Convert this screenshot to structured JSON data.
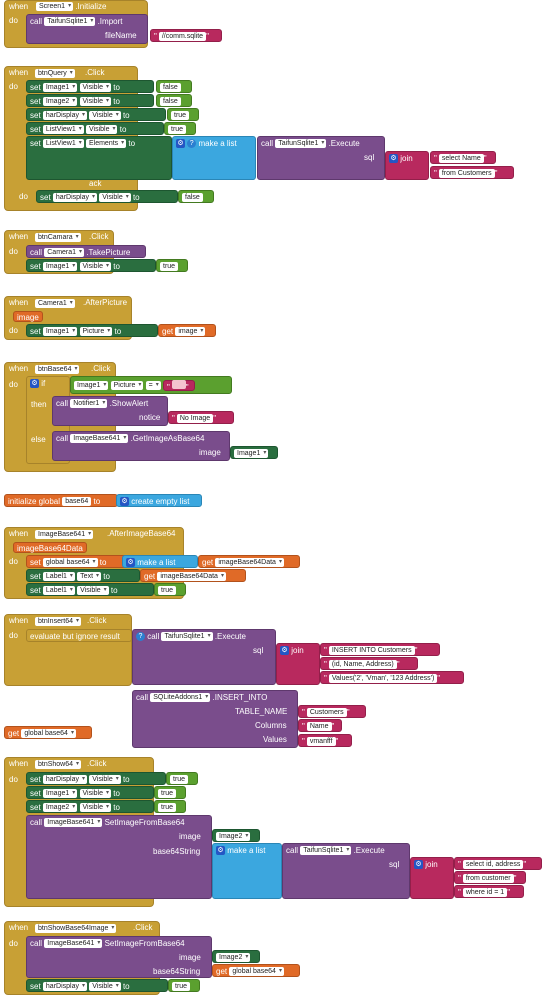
{
  "kw": {
    "when": "when",
    "do": "do",
    "set": "set",
    "to": "to",
    "call": "call",
    "if": "if",
    "then": "then",
    "else": "else",
    "get": "get",
    "make_a_list": "make a list",
    "join": "join",
    "create_empty_list": "create empty list",
    "evaluate_ignore": "evaluate but ignore result"
  },
  "props": {
    "visible": "Visible",
    "picture": "Picture",
    "elements": "Elements",
    "text": "Text",
    "image": "image",
    "filename": "fileName",
    "sql": "sql",
    "notice": "notice",
    "base64string": "base64String",
    "table_name": "TABLE_NAME",
    "columns": "Columns",
    "values": "Values"
  },
  "values": {
    "true": "true",
    "false": "false"
  },
  "block1": {
    "component": "Screen1",
    "event": ".Initialize",
    "call_component": "TaifunSqlite1",
    "method": ".Import",
    "file": "//comm.sqlite"
  },
  "block2": {
    "component": "btnQuery",
    "event": ".Click",
    "image1": "Image1",
    "image2": "Image2",
    "hardisplay": "harDisplay",
    "listview": "ListView1",
    "sqlite": "TaifunSqlite1",
    "method": ".Execute",
    "str1": "select Name",
    "str2": "from Customers",
    "ghost": "ack"
  },
  "block3": {
    "component": "btnCamara",
    "event": ".Click",
    "camera": "Camera1",
    "method": ".TakePicture",
    "image1": "Image1"
  },
  "block4": {
    "component": "Camera1",
    "event": ".AfterPicture",
    "param": "image",
    "image1": "Image1",
    "getvar": "image"
  },
  "block5": {
    "component": "btnBase64",
    "event": ".Click",
    "image1": "Image1",
    "op": "=",
    "notifier": "Notifier1",
    "alert": ".ShowAlert",
    "noimage": "No Image",
    "imagebase": "ImageBase641",
    "getbase64": ".GetImageAsBase64"
  },
  "block6": {
    "label": "initialize global",
    "name": "base64"
  },
  "block7": {
    "component": "ImageBase641",
    "event": ".AfterImageBase64",
    "param": "imageBase64Data",
    "globalvar": "global base64",
    "label1": "Label1"
  },
  "block8": {
    "component": "btnInsert64",
    "event": ".Click",
    "sqlite": "TaifunSqlite1",
    "method": ".Execute",
    "str1": "INSERT INTO Customers",
    "str2": "(id, Name, Address)",
    "str3": "Values('2', 'Vman', '123 Address')"
  },
  "block9": {
    "component": "SQLiteAddons1",
    "method": ".INSERT_INTO",
    "table": "Customers",
    "column": "Name",
    "value": "vmanfff"
  },
  "block10": {
    "getvar": "global base64"
  },
  "block11": {
    "component": "btnShow64",
    "event": ".Click",
    "hardisplay": "harDisplay",
    "image1": "Image1",
    "image2": "Image2",
    "imagebase": "ImageBase641",
    "method": "SetImageFromBase64",
    "sqlite": "TaifunSqlite1",
    "exec": ".Execute",
    "str1": "select id, address",
    "str2": "from customer",
    "str3": "where id = 1"
  },
  "block12": {
    "component": "btnShowBase64Image",
    "event": ".Click",
    "imagebase": "ImageBase641",
    "method": "SetImageFromBase64",
    "image2": "Image2",
    "globalvar": "global base64",
    "hardisplay": "harDisplay"
  }
}
